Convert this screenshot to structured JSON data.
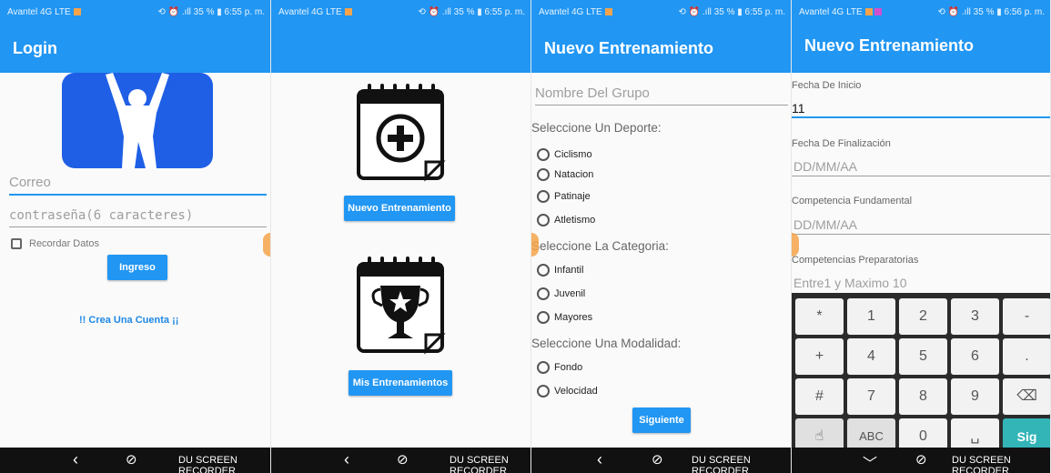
{
  "status_bars": [
    {
      "carrier": "Avantel 4G LTE",
      "right": "⟲ ⏰ .ıll 35 % ▮ 6:55 p. m."
    },
    {
      "carrier": "Avantel 4G LTE",
      "right": "⟲ ⏰ .ıll 35 % ▮ 6:55 p. m."
    },
    {
      "carrier": "Avantel 4G LTE",
      "right": "⟲ ⏰ .ıll 35 % ▮ 6:55 p. m."
    },
    {
      "carrier": "Avantel 4G LTE",
      "right": "⟲ ⏰ .ıll 35 % ▮ 6:56 p. m."
    }
  ],
  "nav": {
    "back": "‹",
    "down": "﹀",
    "du_icon": "⊘",
    "du_text": "DU SCREEN RECORDER"
  },
  "login": {
    "title": "Login",
    "email_placeholder": "Correo",
    "password_placeholder": "contraseña(6 caracteres)",
    "remember_label": "Recordar Datos",
    "login_button": "Ingreso",
    "create_account_link": "!! Crea Una Cuenta ¡¡"
  },
  "menu": {
    "new_training_button": "Nuevo Entrenamiento",
    "my_trainings_button": "Mis Entrenamientos"
  },
  "new_training": {
    "title": "Nuevo Entrenamiento",
    "group_name_placeholder": "Nombre Del Grupo",
    "sport_label": "Seleccione Un Deporte:",
    "sports": [
      "Ciclismo",
      "Natacion",
      "Patinaje",
      "Atletismo"
    ],
    "category_label": "Seleccione La Categoria:",
    "categories": [
      "Infantil",
      "Juvenil",
      "Mayores"
    ],
    "modality_label": "Seleccione Una Modalidad:",
    "modalities": [
      "Fondo",
      "Velocidad"
    ],
    "next_button": "Siguiente"
  },
  "new_training_2": {
    "title": "Nuevo Entrenamiento",
    "start_date_label": "Fecha De Inicio",
    "start_date_value": "11",
    "end_date_label": "Fecha De Finalización",
    "end_date_placeholder": "DD/MM/AA",
    "fundamental_label": "Competencia Fundamental",
    "fundamental_placeholder": "DD/MM/AA",
    "preparatory_label": "Competencias Preparatorias",
    "preparatory_placeholder": "Entre1 y Maximo 10"
  },
  "keyboard": {
    "rows": [
      [
        "*",
        "1",
        "2",
        "3",
        "-"
      ],
      [
        "+",
        "4",
        "5",
        "6",
        "."
      ],
      [
        "#",
        "7",
        "8",
        "9",
        "⌫"
      ],
      [
        "☝",
        "ABC",
        "0",
        "␣",
        "Sig"
      ]
    ]
  },
  "colors": {
    "primary": "#2196f3",
    "accent": "#f5a34a",
    "keyboard_bg": "#2b2b2b",
    "sig_key": "#33b5b8"
  }
}
